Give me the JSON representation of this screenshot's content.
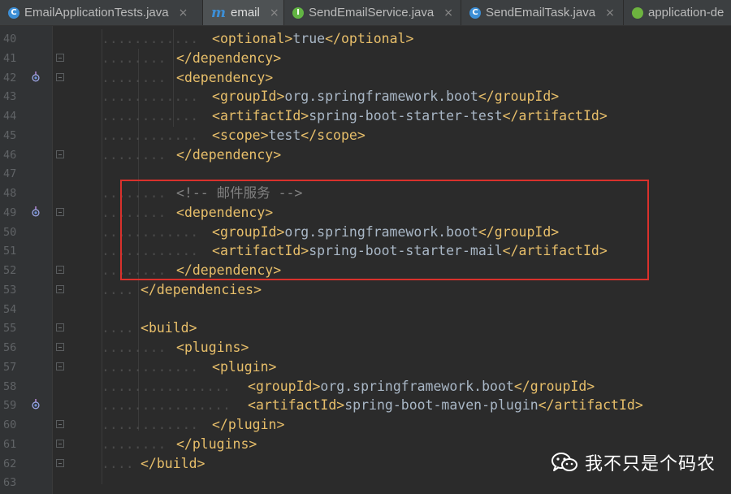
{
  "tabs": [
    {
      "label": "EmailApplicationTests.java",
      "icon": "java-class-icon",
      "icon_letter": "C",
      "icon_color": "#3d8fd6",
      "active": false,
      "closable": true
    },
    {
      "label": "email",
      "icon": "maven-icon",
      "icon_letter": "m",
      "icon_color": "#3d8fd6",
      "active": true,
      "closable": true
    },
    {
      "label": "SendEmailService.java",
      "icon": "java-interface-icon",
      "icon_letter": "I",
      "icon_color": "#62b543",
      "active": false,
      "closable": true
    },
    {
      "label": "SendEmailTask.java",
      "icon": "java-class-icon",
      "icon_letter": "C",
      "icon_color": "#3d8fd6",
      "active": false,
      "closable": true
    },
    {
      "label": "application-de",
      "icon": "spring-icon",
      "icon_letter": "",
      "icon_color": "#6db33f",
      "active": false,
      "closable": false
    }
  ],
  "close_glyph": "×",
  "colors": {
    "tag": "#e8bf6a",
    "text": "#a9b7c6",
    "comment": "#808080",
    "line_number": "#606366",
    "background": "#2b2b2b",
    "highlight_border": "#d9312c"
  },
  "code_lines": [
    {
      "num": "40",
      "indent": 4,
      "parts": [
        {
          "t": "<",
          "c": "punct"
        },
        {
          "t": "optional",
          "c": "tag"
        },
        {
          "t": ">",
          "c": "punct"
        },
        {
          "t": "true",
          "c": "txt"
        },
        {
          "t": "</",
          "c": "punct"
        },
        {
          "t": "optional",
          "c": "tag"
        },
        {
          "t": ">",
          "c": "punct"
        }
      ],
      "fold": false,
      "vcs": false
    },
    {
      "num": "41",
      "indent": 3,
      "parts": [
        {
          "t": "</",
          "c": "punct"
        },
        {
          "t": "dependency",
          "c": "tag"
        },
        {
          "t": ">",
          "c": "punct"
        }
      ],
      "fold": true,
      "vcs": false
    },
    {
      "num": "42",
      "indent": 3,
      "parts": [
        {
          "t": "<",
          "c": "punct"
        },
        {
          "t": "dependency",
          "c": "tag"
        },
        {
          "t": ">",
          "c": "punct"
        }
      ],
      "fold": true,
      "vcs": true
    },
    {
      "num": "43",
      "indent": 4,
      "parts": [
        {
          "t": "<",
          "c": "punct"
        },
        {
          "t": "groupId",
          "c": "tag"
        },
        {
          "t": ">",
          "c": "punct"
        },
        {
          "t": "org.springframework.boot",
          "c": "txt"
        },
        {
          "t": "</",
          "c": "punct"
        },
        {
          "t": "groupId",
          "c": "tag"
        },
        {
          "t": ">",
          "c": "punct"
        }
      ],
      "fold": false,
      "vcs": false
    },
    {
      "num": "44",
      "indent": 4,
      "parts": [
        {
          "t": "<",
          "c": "punct"
        },
        {
          "t": "artifactId",
          "c": "tag"
        },
        {
          "t": ">",
          "c": "punct"
        },
        {
          "t": "spring-boot-starter-test",
          "c": "txt"
        },
        {
          "t": "</",
          "c": "punct"
        },
        {
          "t": "artifactId",
          "c": "tag"
        },
        {
          "t": ">",
          "c": "punct"
        }
      ],
      "fold": false,
      "vcs": false
    },
    {
      "num": "45",
      "indent": 4,
      "parts": [
        {
          "t": "<",
          "c": "punct"
        },
        {
          "t": "scope",
          "c": "tag"
        },
        {
          "t": ">",
          "c": "punct"
        },
        {
          "t": "test",
          "c": "txt"
        },
        {
          "t": "</",
          "c": "punct"
        },
        {
          "t": "scope",
          "c": "tag"
        },
        {
          "t": ">",
          "c": "punct"
        }
      ],
      "fold": false,
      "vcs": false
    },
    {
      "num": "46",
      "indent": 3,
      "parts": [
        {
          "t": "</",
          "c": "punct"
        },
        {
          "t": "dependency",
          "c": "tag"
        },
        {
          "t": ">",
          "c": "punct"
        }
      ],
      "fold": true,
      "vcs": false
    },
    {
      "num": "47",
      "indent": 0,
      "parts": [],
      "fold": false,
      "vcs": false
    },
    {
      "num": "48",
      "indent": 3,
      "parts": [
        {
          "t": "<!-- 邮件服务 -->",
          "c": "comment"
        }
      ],
      "fold": false,
      "vcs": false
    },
    {
      "num": "49",
      "indent": 3,
      "parts": [
        {
          "t": "<",
          "c": "punct"
        },
        {
          "t": "dependency",
          "c": "tag"
        },
        {
          "t": ">",
          "c": "punct"
        }
      ],
      "fold": true,
      "vcs": true
    },
    {
      "num": "50",
      "indent": 4,
      "parts": [
        {
          "t": "<",
          "c": "punct"
        },
        {
          "t": "groupId",
          "c": "tag"
        },
        {
          "t": ">",
          "c": "punct"
        },
        {
          "t": "org.springframework.boot",
          "c": "txt"
        },
        {
          "t": "</",
          "c": "punct"
        },
        {
          "t": "groupId",
          "c": "tag"
        },
        {
          "t": ">",
          "c": "punct"
        }
      ],
      "fold": false,
      "vcs": false
    },
    {
      "num": "51",
      "indent": 4,
      "parts": [
        {
          "t": "<",
          "c": "punct"
        },
        {
          "t": "artifactId",
          "c": "tag"
        },
        {
          "t": ">",
          "c": "punct"
        },
        {
          "t": "spring-boot-starter-mail",
          "c": "txt"
        },
        {
          "t": "</",
          "c": "punct"
        },
        {
          "t": "artifactId",
          "c": "tag"
        },
        {
          "t": ">",
          "c": "punct"
        }
      ],
      "fold": false,
      "vcs": false
    },
    {
      "num": "52",
      "indent": 3,
      "parts": [
        {
          "t": "</",
          "c": "punct"
        },
        {
          "t": "dependency",
          "c": "tag"
        },
        {
          "t": ">",
          "c": "punct"
        }
      ],
      "fold": true,
      "vcs": false
    },
    {
      "num": "53",
      "indent": 2,
      "parts": [
        {
          "t": "</",
          "c": "punct"
        },
        {
          "t": "dependencies",
          "c": "tag"
        },
        {
          "t": ">",
          "c": "punct"
        }
      ],
      "fold": true,
      "vcs": false
    },
    {
      "num": "54",
      "indent": 0,
      "parts": [],
      "fold": false,
      "vcs": false
    },
    {
      "num": "55",
      "indent": 2,
      "parts": [
        {
          "t": "<",
          "c": "punct"
        },
        {
          "t": "build",
          "c": "tag"
        },
        {
          "t": ">",
          "c": "punct"
        }
      ],
      "fold": true,
      "vcs": false
    },
    {
      "num": "56",
      "indent": 3,
      "parts": [
        {
          "t": "<",
          "c": "punct"
        },
        {
          "t": "plugins",
          "c": "tag"
        },
        {
          "t": ">",
          "c": "punct"
        }
      ],
      "fold": true,
      "vcs": false
    },
    {
      "num": "57",
      "indent": 4,
      "parts": [
        {
          "t": "<",
          "c": "punct"
        },
        {
          "t": "plugin",
          "c": "tag"
        },
        {
          "t": ">",
          "c": "punct"
        }
      ],
      "fold": true,
      "vcs": false
    },
    {
      "num": "58",
      "indent": 5,
      "parts": [
        {
          "t": "<",
          "c": "punct"
        },
        {
          "t": "groupId",
          "c": "tag"
        },
        {
          "t": ">",
          "c": "punct"
        },
        {
          "t": "org.springframework.boot",
          "c": "txt"
        },
        {
          "t": "</",
          "c": "punct"
        },
        {
          "t": "groupId",
          "c": "tag"
        },
        {
          "t": ">",
          "c": "punct"
        }
      ],
      "fold": false,
      "vcs": false
    },
    {
      "num": "59",
      "indent": 5,
      "parts": [
        {
          "t": "<",
          "c": "punct"
        },
        {
          "t": "artifactId",
          "c": "tag"
        },
        {
          "t": ">",
          "c": "punct"
        },
        {
          "t": "spring-boot-maven-plugin",
          "c": "txt"
        },
        {
          "t": "</",
          "c": "punct"
        },
        {
          "t": "artifactId",
          "c": "tag"
        },
        {
          "t": ">",
          "c": "punct"
        }
      ],
      "fold": false,
      "vcs": true
    },
    {
      "num": "60",
      "indent": 4,
      "parts": [
        {
          "t": "</",
          "c": "punct"
        },
        {
          "t": "plugin",
          "c": "tag"
        },
        {
          "t": ">",
          "c": "punct"
        }
      ],
      "fold": true,
      "vcs": false
    },
    {
      "num": "61",
      "indent": 3,
      "parts": [
        {
          "t": "</",
          "c": "punct"
        },
        {
          "t": "plugins",
          "c": "tag"
        },
        {
          "t": ">",
          "c": "punct"
        }
      ],
      "fold": true,
      "vcs": false
    },
    {
      "num": "62",
      "indent": 2,
      "parts": [
        {
          "t": "</",
          "c": "punct"
        },
        {
          "t": "build",
          "c": "tag"
        },
        {
          "t": ">",
          "c": "punct"
        }
      ],
      "fold": true,
      "vcs": false
    },
    {
      "num": "63",
      "indent": 0,
      "parts": [],
      "fold": false,
      "vcs": false
    }
  ],
  "watermark": {
    "text": "我不只是个码农",
    "icon": "wechat-icon"
  }
}
